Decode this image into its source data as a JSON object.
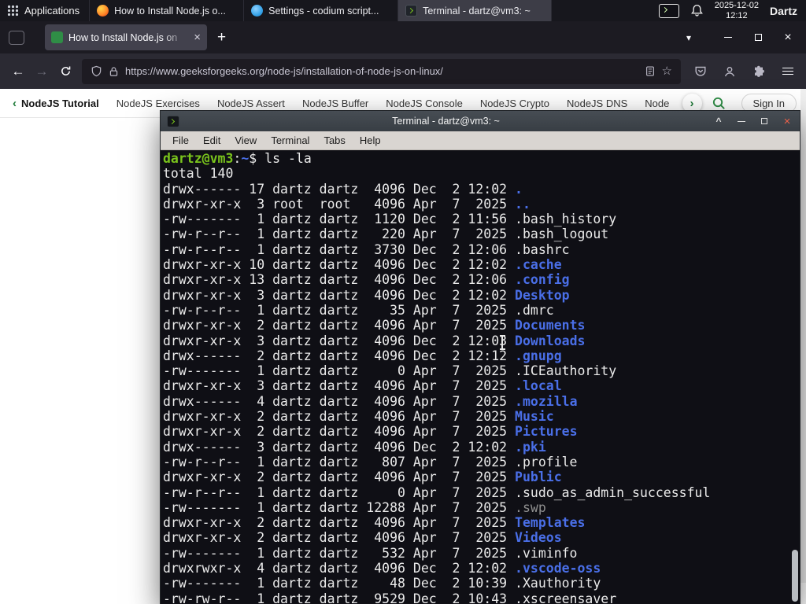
{
  "colors": {
    "panel_bg": "#17171d",
    "accent_green": "#2f8d46",
    "firefox_orange": "#ff8a2a",
    "codium_blue": "#36a3e8",
    "term_green": "#7ac41c",
    "term_blue": "#4a6fe8",
    "term_gray": "#8f8f8f",
    "term_fg": "#ebebeb",
    "term_bg": "#0f0f15"
  },
  "panel": {
    "applications_label": "Applications",
    "windows": [
      {
        "label": "How to Install Node.js o...",
        "icon": "firefox",
        "active": false
      },
      {
        "label": "Settings - codium script...",
        "icon": "codium",
        "active": false
      },
      {
        "label": "Terminal - dartz@vm3: ~",
        "icon": "terminal",
        "active": true
      }
    ],
    "clock": {
      "date": "2025-12-02",
      "time": "12:12"
    },
    "user_label": "Dartz"
  },
  "browser": {
    "tab": {
      "title": "How to Install Node.js on",
      "close_glyph": "×"
    },
    "new_tab_glyph": "+",
    "list_tabs_glyph": "▾",
    "window_close_glyph": "×",
    "nav": {
      "back_glyph": "←",
      "forward_glyph": "→"
    },
    "urlbar": {
      "url": "https://www.geeksforgeeks.org/node-js/installation-of-node-js-on-linux/",
      "star_glyph": "☆"
    }
  },
  "site_nav": {
    "back_chevron": "‹",
    "more_chevron": "›",
    "items": [
      "NodeJS Tutorial",
      "NodeJS Exercises",
      "NodeJS Assert",
      "NodeJS Buffer",
      "NodeJS Console",
      "NodeJS Crypto",
      "NodeJS DNS",
      "Node"
    ],
    "sign_in_label": "Sign In"
  },
  "terminal": {
    "title": "Terminal - dartz@vm3: ~",
    "menu": [
      "File",
      "Edit",
      "View",
      "Terminal",
      "Tabs",
      "Help"
    ],
    "controls": {
      "shade_glyph": "^",
      "close_glyph": "×"
    },
    "lines": [
      [
        [
          "dartz@vm3",
          "green"
        ],
        [
          ":",
          "white"
        ],
        [
          "~",
          "blue"
        ],
        [
          "$ ",
          "white"
        ],
        [
          "ls -la",
          "white"
        ]
      ],
      [
        [
          "total 140",
          "white"
        ]
      ],
      [
        [
          "drwx------ 17 dartz dartz  4096 Dec  2 12:02 ",
          "white"
        ],
        [
          ".",
          "blue"
        ]
      ],
      [
        [
          "drwxr-xr-x  3 root  root   4096 Apr  7  2025 ",
          "white"
        ],
        [
          "..",
          "blue"
        ]
      ],
      [
        [
          "-rw-------  1 dartz dartz  1120 Dec  2 11:56 .bash_history",
          "white"
        ]
      ],
      [
        [
          "-rw-r--r--  1 dartz dartz   220 Apr  7  2025 .bash_logout",
          "white"
        ]
      ],
      [
        [
          "-rw-r--r--  1 dartz dartz  3730 Dec  2 12:06 .bashrc",
          "white"
        ]
      ],
      [
        [
          "drwxr-xr-x 10 dartz dartz  4096 Dec  2 12:02 ",
          "white"
        ],
        [
          ".cache",
          "blue"
        ]
      ],
      [
        [
          "drwxr-xr-x 13 dartz dartz  4096 Dec  2 12:06 ",
          "white"
        ],
        [
          ".config",
          "blue"
        ]
      ],
      [
        [
          "drwxr-xr-x  3 dartz dartz  4096 Dec  2 12:02 ",
          "white"
        ],
        [
          "Desktop",
          "blue"
        ]
      ],
      [
        [
          "-rw-r--r--  1 dartz dartz    35 Apr  7  2025 .dmrc",
          "white"
        ]
      ],
      [
        [
          "drwxr-xr-x  2 dartz dartz  4096 Apr  7  2025 ",
          "white"
        ],
        [
          "Documents",
          "blue"
        ]
      ],
      [
        [
          "drwxr-xr-x  3 dartz dartz  4096 Dec  2 12:03 ",
          "white"
        ],
        [
          "Downloads",
          "blue"
        ]
      ],
      [
        [
          "drwx------  2 dartz dartz  4096 Dec  2 12:12 ",
          "white"
        ],
        [
          ".gnupg",
          "blue"
        ]
      ],
      [
        [
          "-rw-------  1 dartz dartz     0 Apr  7  2025 .ICEauthority",
          "white"
        ]
      ],
      [
        [
          "drwxr-xr-x  3 dartz dartz  4096 Apr  7  2025 ",
          "white"
        ],
        [
          ".local",
          "blue"
        ]
      ],
      [
        [
          "drwx------  4 dartz dartz  4096 Apr  7  2025 ",
          "white"
        ],
        [
          ".mozilla",
          "blue"
        ]
      ],
      [
        [
          "drwxr-xr-x  2 dartz dartz  4096 Apr  7  2025 ",
          "white"
        ],
        [
          "Music",
          "blue"
        ]
      ],
      [
        [
          "drwxr-xr-x  2 dartz dartz  4096 Apr  7  2025 ",
          "white"
        ],
        [
          "Pictures",
          "blue"
        ]
      ],
      [
        [
          "drwx------  3 dartz dartz  4096 Dec  2 12:02 ",
          "white"
        ],
        [
          ".pki",
          "blue"
        ]
      ],
      [
        [
          "-rw-r--r--  1 dartz dartz   807 Apr  7  2025 .profile",
          "white"
        ]
      ],
      [
        [
          "drwxr-xr-x  2 dartz dartz  4096 Apr  7  2025 ",
          "white"
        ],
        [
          "Public",
          "blue"
        ]
      ],
      [
        [
          "-rw-r--r--  1 dartz dartz     0 Apr  7  2025 .sudo_as_admin_successful",
          "white"
        ]
      ],
      [
        [
          "-rw-------  1 dartz dartz 12288 Apr  7  2025 ",
          "white"
        ],
        [
          ".swp",
          "gray"
        ]
      ],
      [
        [
          "drwxr-xr-x  2 dartz dartz  4096 Apr  7  2025 ",
          "white"
        ],
        [
          "Templates",
          "blue"
        ]
      ],
      [
        [
          "drwxr-xr-x  2 dartz dartz  4096 Apr  7  2025 ",
          "white"
        ],
        [
          "Videos",
          "blue"
        ]
      ],
      [
        [
          "-rw-------  1 dartz dartz   532 Apr  7  2025 .viminfo",
          "white"
        ]
      ],
      [
        [
          "drwxrwxr-x  4 dartz dartz  4096 Dec  2 12:02 ",
          "white"
        ],
        [
          ".vscode-oss",
          "blue"
        ]
      ],
      [
        [
          "-rw-------  1 dartz dartz    48 Dec  2 10:39 .Xauthority",
          "white"
        ]
      ],
      [
        [
          "-rw-rw-r--  1 dartz dartz  9529 Dec  2 10:43 .xscreensaver",
          "white"
        ]
      ]
    ]
  }
}
